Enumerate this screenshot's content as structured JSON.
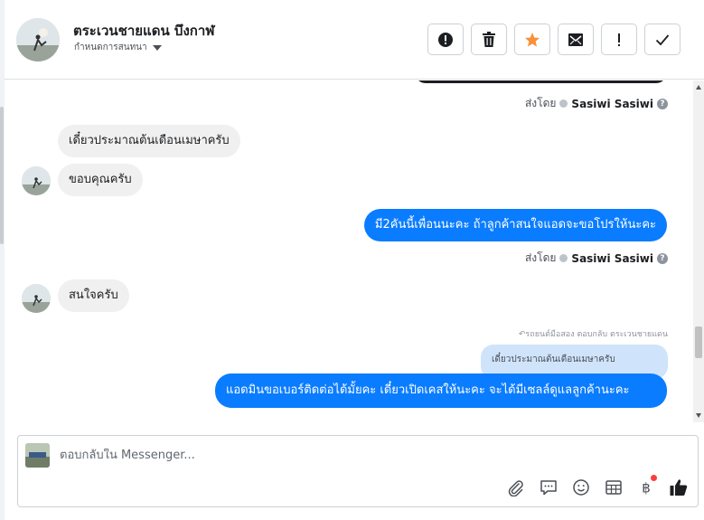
{
  "header": {
    "contact_name": "ตระเวนชายแดน บึงกาฬ",
    "assign_label": "กำหนดการสนทนา",
    "actions": [
      {
        "name": "report-spam-button",
        "icon": "alert-circle-icon"
      },
      {
        "name": "delete-button",
        "icon": "trash-icon"
      },
      {
        "name": "star-button",
        "icon": "star-icon"
      },
      {
        "name": "mark-unread-button",
        "icon": "envelope-icon"
      },
      {
        "name": "follow-up-button",
        "icon": "exclamation-icon"
      },
      {
        "name": "mark-done-button",
        "icon": "check-icon"
      }
    ],
    "star_color": "#f7923b"
  },
  "conversation": {
    "sent_by_label": "ส่งโดย",
    "sender_name": "Sasiwi Sasiwi",
    "messages": [
      {
        "dir": "in",
        "text": "เดี๋ยวประมาณต้นเดือนเมษาครับ"
      },
      {
        "dir": "in",
        "text": "ขอบคุณครับ"
      },
      {
        "dir": "out",
        "text": "มี2คันนี้เพื่อนนะคะ ถ้าลูกค้าสนใจแอดจะขอโปรให้นะคะ"
      },
      {
        "dir": "in",
        "text": "สนใจครับ"
      },
      {
        "dir": "out",
        "text": "แอดมินขอเบอร์ติดต่อได้มั้ยคะ เดี๋ยวเปิดเคสให้นะคะ จะได้มีเซลล์ดูแลลูกค้านะคะ"
      }
    ],
    "reply_note": "รถยนต์มือสอง ตอบกลับ ตระเวนชายแดน",
    "quoted_text": "เดี๋ยวประมาณต้นเดือนเมษาครับ",
    "bubble_out_color": "#0a7cff",
    "bubble_in_color": "#f0f0f0"
  },
  "composer": {
    "placeholder": "ตอบกลับใน Messenger...",
    "tools": [
      "paperclip-icon",
      "speech-bubble-icon",
      "smiley-icon",
      "table-icon",
      "baht-icon",
      "thumbs-up-icon"
    ]
  }
}
